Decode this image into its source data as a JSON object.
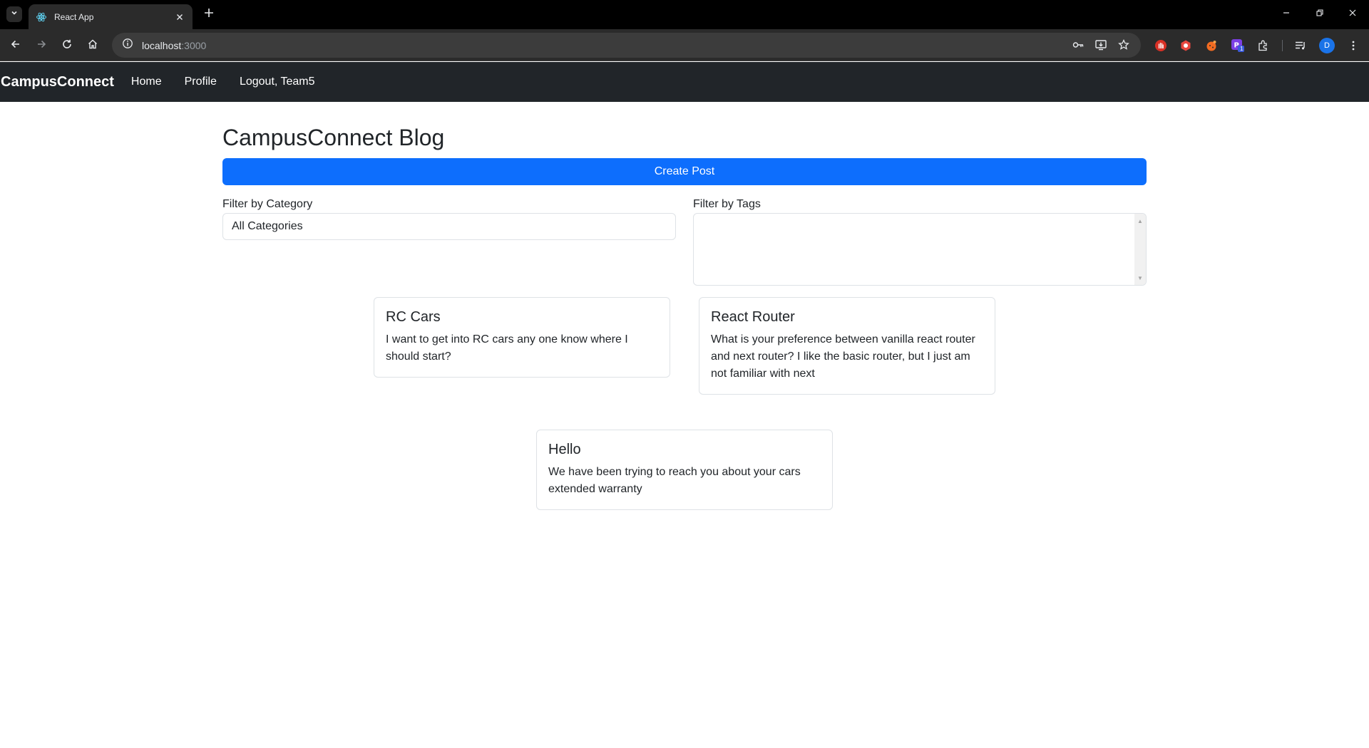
{
  "browser": {
    "tab_title": "React App",
    "url_host": "localhost",
    "url_port": ":3000",
    "profile_initial": "D",
    "extension_badge": "1"
  },
  "navbar": {
    "brand": "CampusConnect",
    "links": [
      "Home",
      "Profile",
      "Logout, Team5"
    ]
  },
  "page": {
    "title": "CampusConnect Blog",
    "create_button": "Create Post",
    "category_filter": {
      "label": "Filter by Category",
      "selected": "All Categories"
    },
    "tags_filter": {
      "label": "Filter by Tags"
    }
  },
  "posts": [
    {
      "title": "RC Cars",
      "body": "I want to get into RC cars any one know where I should start?"
    },
    {
      "title": "React Router",
      "body": "What is your preference between vanilla react router and next router? I like the basic router, but I just am not familiar with next"
    },
    {
      "title": "Hello",
      "body": "We have been trying to reach you about your cars extended warranty"
    }
  ],
  "colors": {
    "navbar_bg": "#212529",
    "primary": "#0d6efd",
    "chrome_bg": "#000000",
    "toolbar_bg": "#2b2b2b"
  }
}
